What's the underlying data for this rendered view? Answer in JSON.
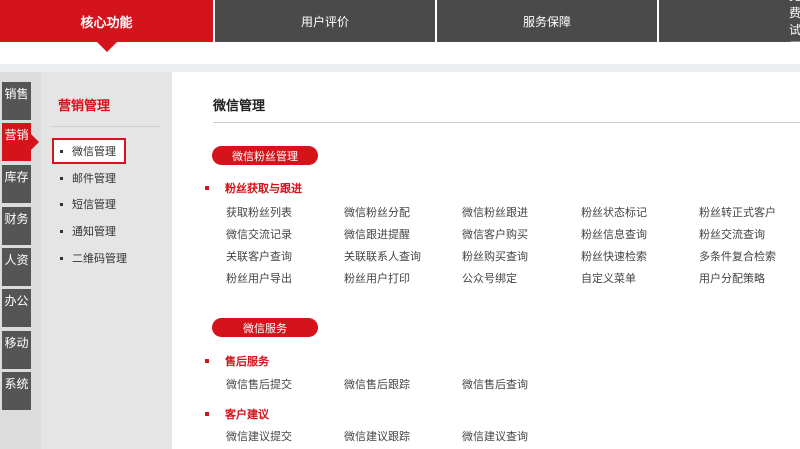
{
  "top_tabs": [
    {
      "label": "核心功能",
      "active": true
    },
    {
      "label": "用户评价",
      "active": false
    },
    {
      "label": "服务保障",
      "active": false
    },
    {
      "label": "免费试用",
      "active": false
    }
  ],
  "left_tabs": [
    {
      "label": "销售",
      "active": false
    },
    {
      "label": "营销",
      "active": true
    },
    {
      "label": "库存",
      "active": false
    },
    {
      "label": "财务",
      "active": false
    },
    {
      "label": "人资",
      "active": false
    },
    {
      "label": "办公",
      "active": false
    },
    {
      "label": "移动",
      "active": false
    },
    {
      "label": "系统",
      "active": false
    }
  ],
  "submenu": {
    "title": "营销管理",
    "items": [
      {
        "label": "微信管理",
        "active": true
      },
      {
        "label": "邮件管理",
        "active": false
      },
      {
        "label": "短信管理",
        "active": false
      },
      {
        "label": "通知管理",
        "active": false
      },
      {
        "label": "二维码管理",
        "active": false
      }
    ]
  },
  "main": {
    "title": "微信管理",
    "sections": [
      {
        "pill": "微信粉丝管理",
        "groups": [
          {
            "title": "粉丝获取与跟进",
            "rows": [
              [
                "获取粉丝列表",
                "微信粉丝分配",
                "微信粉丝跟进",
                "粉丝状态标记",
                "粉丝转正式客户"
              ],
              [
                "微信交流记录",
                "微信跟进提醒",
                "微信客户购买",
                "粉丝信息查询",
                "粉丝交流查询"
              ],
              [
                "关联客户查询",
                "关联联系人查询",
                "粉丝购买查询",
                "粉丝快速检索",
                "多条件复合检索"
              ],
              [
                "粉丝用户导出",
                "粉丝用户打印",
                "公众号绑定",
                "自定义菜单",
                "用户分配策略"
              ]
            ]
          }
        ]
      },
      {
        "pill": "微信服务",
        "groups": [
          {
            "title": "售后服务",
            "rows": [
              [
                "微信售后提交",
                "微信售后跟踪",
                "微信售后查询"
              ]
            ]
          },
          {
            "title": "客户建议",
            "rows": [
              [
                "微信建议提交",
                "微信建议跟踪",
                "微信建议查询"
              ]
            ]
          }
        ]
      }
    ]
  },
  "colors": {
    "accent": "#d5131b",
    "nav_dark": "#4a4a4a"
  }
}
